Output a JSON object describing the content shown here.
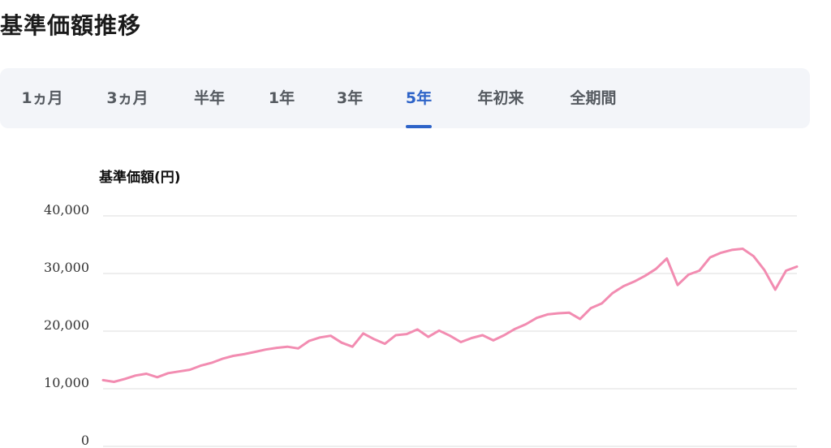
{
  "page_title": "基準価額推移",
  "tabs": [
    {
      "label": "1ヵ月",
      "active": false
    },
    {
      "label": "3ヵ月",
      "active": false
    },
    {
      "label": "半年",
      "active": false
    },
    {
      "label": "1年",
      "active": false
    },
    {
      "label": "3年",
      "active": false
    },
    {
      "label": "5年",
      "active": true
    },
    {
      "label": "年初来",
      "active": false
    },
    {
      "label": "全期間",
      "active": false
    }
  ],
  "colors": {
    "accent": "#2d63c8",
    "line": "#f28cb1",
    "grid": "#dddddd",
    "tab_bg": "#f3f5f9"
  },
  "chart_data": {
    "type": "line",
    "title": "",
    "ylabel": "基準価額(円)",
    "xlabel": "",
    "ylim": [
      0,
      40000
    ],
    "yticks": [
      0,
      10000,
      20000,
      30000,
      40000
    ],
    "ytick_labels": [
      "0",
      "10,000",
      "20,000",
      "30,000",
      "40,000"
    ],
    "grid": true,
    "series": [
      {
        "values": [
          11500,
          11200,
          11700,
          12300,
          12600,
          12000,
          12700,
          13000,
          13300,
          14000,
          14500,
          15200,
          15700,
          16000,
          16400,
          16800,
          17100,
          17300,
          17000,
          18300,
          18900,
          19200,
          18000,
          17300,
          19600,
          18600,
          17800,
          19300,
          19500,
          20300,
          19000,
          20100,
          19200,
          18100,
          18800,
          19300,
          18400,
          19300,
          20400,
          21200,
          22300,
          22900,
          23100,
          23200,
          22100,
          24000,
          24800,
          26600,
          27800,
          28600,
          29600,
          30800,
          32600,
          28000,
          29800,
          30500,
          32800,
          33600,
          34100,
          34300,
          33000,
          30600,
          27200,
          30500,
          31200
        ]
      }
    ]
  }
}
